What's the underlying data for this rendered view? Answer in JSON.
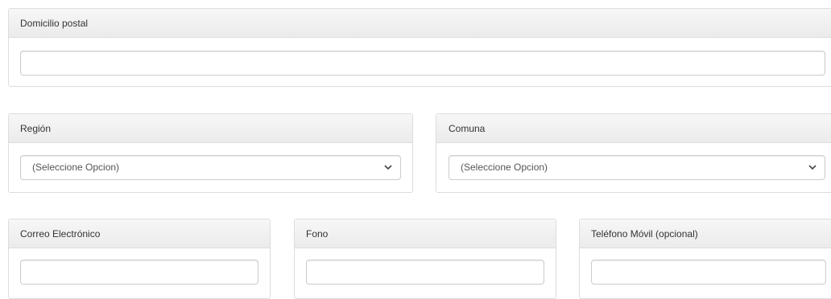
{
  "domicilio": {
    "label": "Domicilio postal",
    "value": ""
  },
  "region": {
    "label": "Región",
    "selected": "(Seleccione Opcion)"
  },
  "comuna": {
    "label": "Comuna",
    "selected": "(Seleccione Opcion)"
  },
  "correo": {
    "label": "Correo Electrónico",
    "value": ""
  },
  "fono": {
    "label": "Fono",
    "value": ""
  },
  "movil": {
    "label": "Teléfono Móvil (opcional)",
    "value": ""
  }
}
